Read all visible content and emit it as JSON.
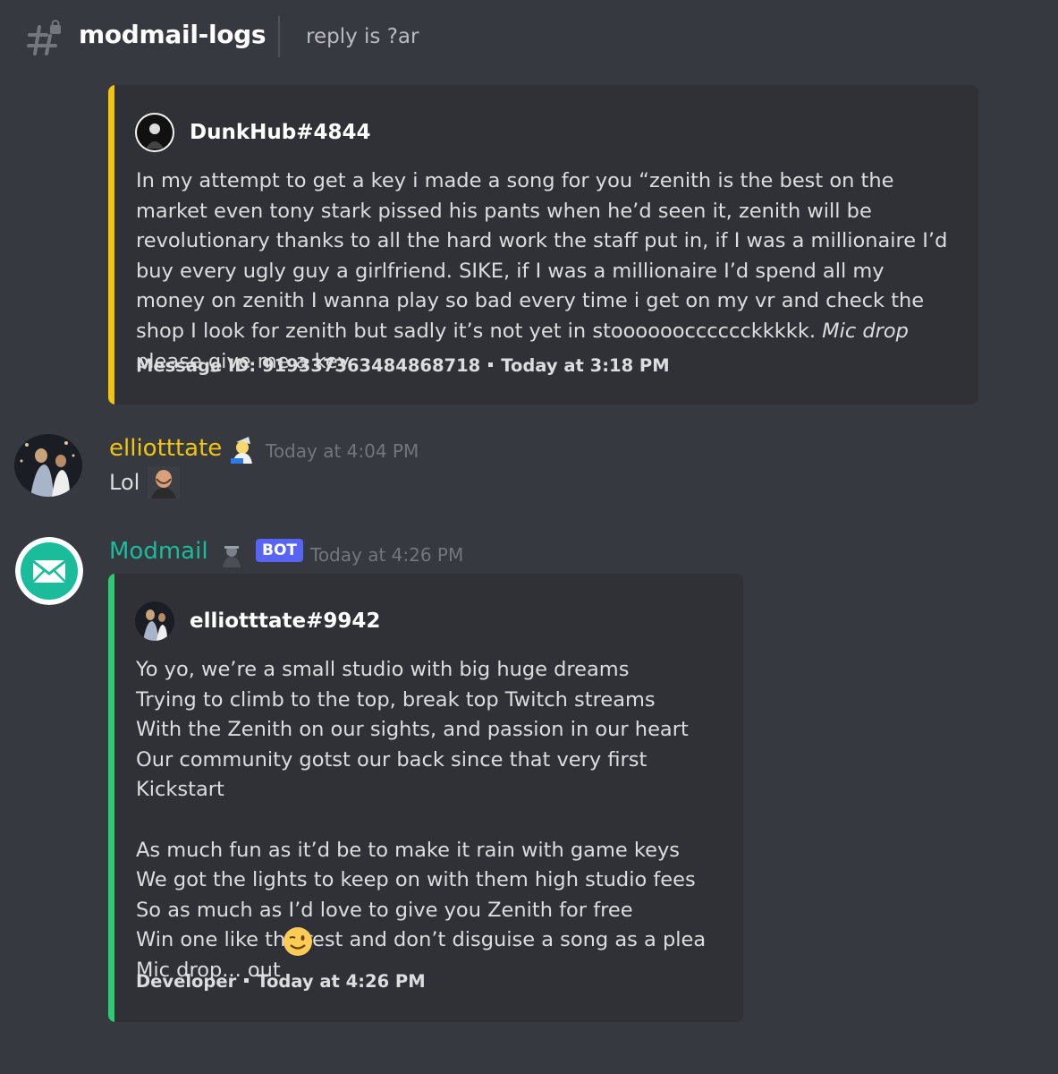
{
  "header": {
    "channel_name": "modmail-logs",
    "topic": "reply is ?ar",
    "icon": "locked-hash-icon"
  },
  "embed1": {
    "accent_color": "#f1c40f",
    "author": "DunkHub#4844",
    "description_before": "In my attempt to get a key i made a song for you “zenith is the best on the market even tony stark pissed his pants when he’d seen it, zenith will be revolutionary thanks to all the hard work the staff put in, if I was a millionaire I’d buy every ugly guy a girlfriend. SIKE, if I was a millionaire I’d spend all my money on zenith I wanna play so bad every time i get on my vr and check the shop I look for zenith but sadly it’s not yet in stoooooocccccckkkkk. ",
    "description_italic": "Mic drop",
    "description_after": " please give me a key",
    "footer_id": "Message ID: 919337363484868718",
    "footer_time": "Today at 3:18 PM"
  },
  "message1": {
    "username": "elliotttate",
    "username_color": "#f1c40f",
    "timestamp": "Today at 4:04 PM",
    "text": "Lol"
  },
  "message2": {
    "username": "Modmail",
    "username_color": "#1abc9c",
    "bot_tag": "BOT",
    "timestamp": "Today at 4:26 PM",
    "avatar_icon": "envelope-icon"
  },
  "embed2": {
    "accent_color": "#2ecc71",
    "author": "elliotttate#9942",
    "description": "Yo yo, we’re a small studio with big huge dreams\nTrying to climb to the top, break top Twitch streams\nWith the Zenith on our sights, and passion in our heart\nOur community gotst our back since that very first Kickstart\n\nAs much fun as it’d be to make it rain with game keys\nWe got the lights to keep on with them high studio fees\nSo as much as I’d love to give you Zenith for free\nWin one like the rest and don’t disguise a song as a plea\nMic drop... out",
    "footer_role": "Developer",
    "footer_time": "Today at 4:26 PM"
  }
}
